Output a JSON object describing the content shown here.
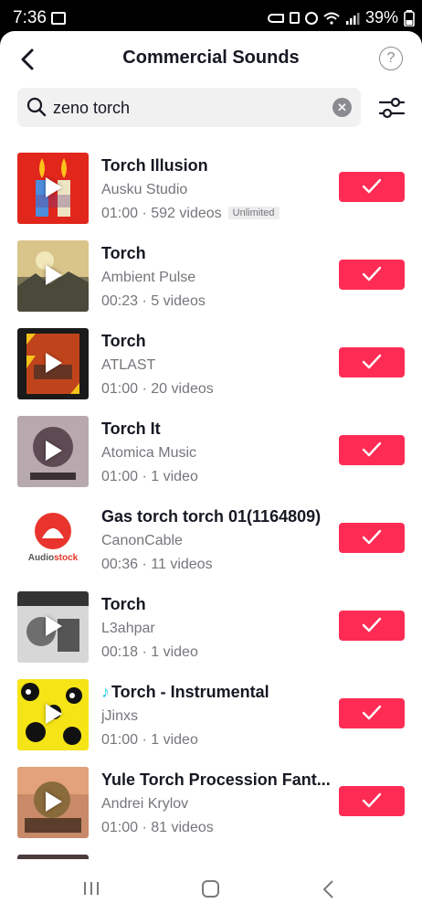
{
  "status": {
    "time": "7:36",
    "battery": "39%"
  },
  "header": {
    "title": "Commercial Sounds",
    "help_label": "?"
  },
  "search": {
    "value": "zeno torch",
    "clear_label": "✕"
  },
  "sounds": [
    {
      "title": "Torch Illusion",
      "artist": "Ausku Studio",
      "meta": "01:00 · 592 videos",
      "badge": "Unlimited",
      "note_prefix": ""
    },
    {
      "title": "Torch",
      "artist": "Ambient Pulse",
      "meta": "00:23 · 5 videos",
      "badge": "",
      "note_prefix": ""
    },
    {
      "title": "Torch",
      "artist": "ATLAST",
      "meta": "01:00 · 20 videos",
      "badge": "",
      "note_prefix": ""
    },
    {
      "title": "Torch It",
      "artist": "Atomica Music",
      "meta": "01:00 · 1 video",
      "badge": "",
      "note_prefix": ""
    },
    {
      "title": "Gas torch torch 01(1164809)",
      "artist": "CanonCable",
      "meta": "00:36 · 11 videos",
      "badge": "",
      "note_prefix": ""
    },
    {
      "title": "Torch",
      "artist": "L3ahpar",
      "meta": "00:18 · 1 video",
      "badge": "",
      "note_prefix": ""
    },
    {
      "title": "Torch - Instrumental",
      "artist": "jJinxs",
      "meta": "01:00 · 1 video",
      "badge": "",
      "note_prefix": "♪"
    },
    {
      "title": "Yule Torch Procession Fant...",
      "artist": "Andrei Krylov",
      "meta": "01:00 · 81 videos",
      "badge": "",
      "note_prefix": ""
    }
  ],
  "thumb_art": {
    "audiostock_logo": {
      "part1": "Audio",
      "part2": "stock"
    }
  },
  "colors": {
    "accent": "#fe2c55",
    "text_primary": "#161823",
    "text_secondary": "#75767b",
    "search_bg": "#f1f1f2"
  }
}
